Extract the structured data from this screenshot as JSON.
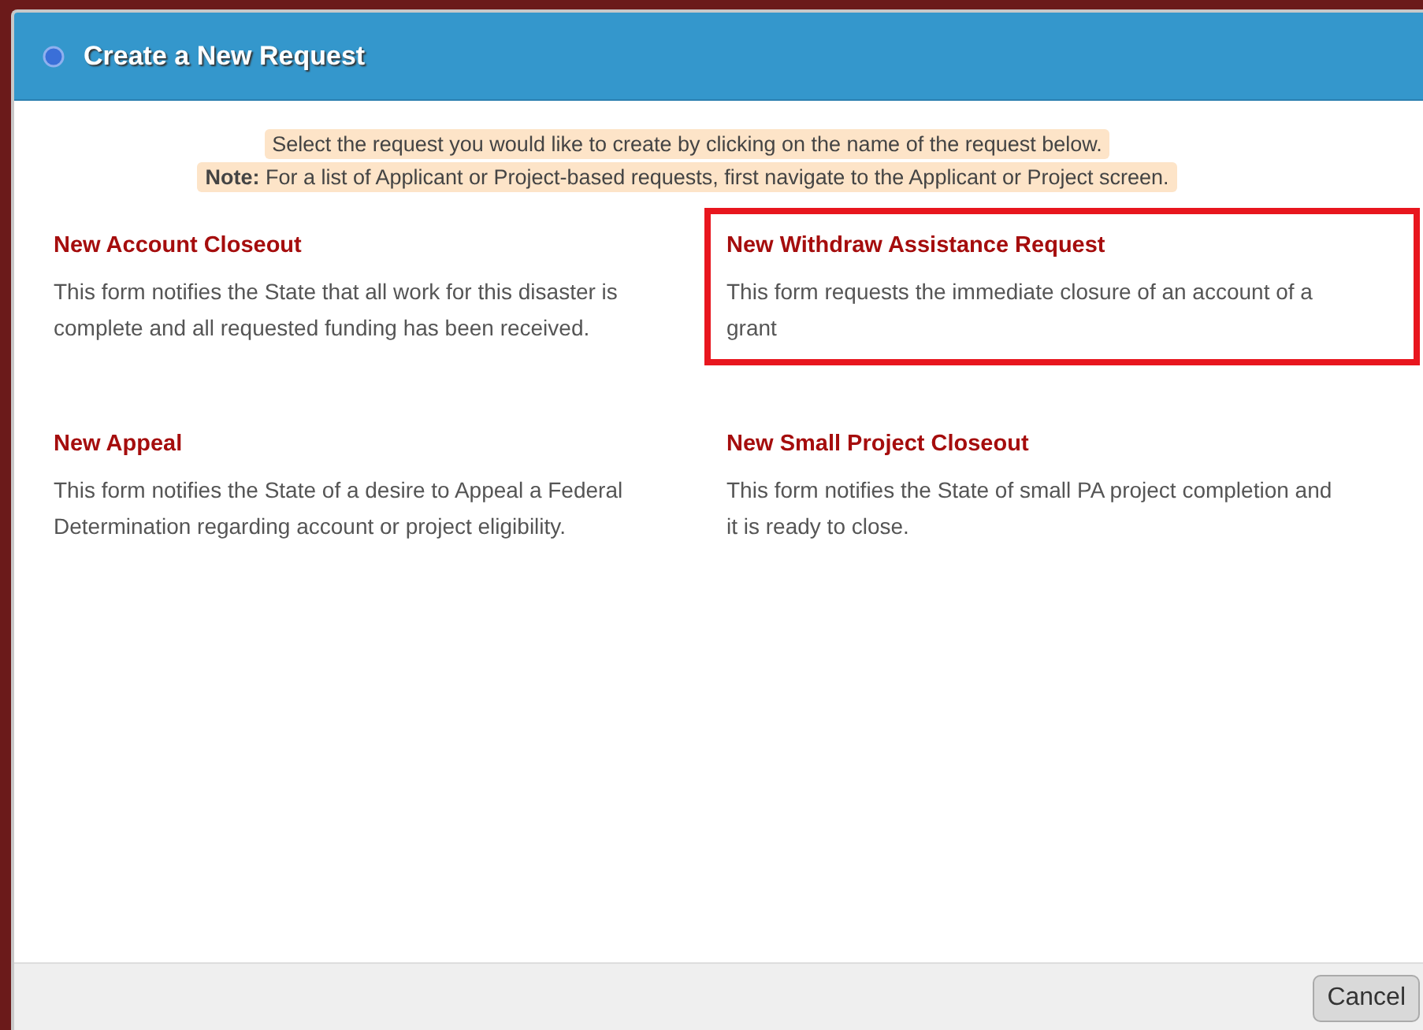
{
  "dialog": {
    "title": "Create a New Request"
  },
  "instructions": {
    "line_1": "Select the request you would like to create by clicking on the name of the request below.",
    "line_2": "**Note:** For a list of Applicant or Project-based requests, first navigate to the Applicant or Project screen."
  },
  "requests": [
    {
      "title": "New Account Closeout",
      "description": "This form notifies the State that all work for this disaster is complete and all requested funding has been received.",
      "highlighted": false
    },
    {
      "title": "New Withdraw Assistance Request",
      "description": "This form requests the immediate closure of an account of a grant",
      "highlighted": true
    },
    {
      "title": "New Appeal",
      "description": "This form notifies the State of a desire to Appeal a Federal Determination regarding account or project eligibility.",
      "highlighted": false
    },
    {
      "title": "New Small Project Closeout",
      "description": "This form notifies the State of small PA project completion and it is ready to close.",
      "highlighted": false
    }
  ],
  "buttons": [
    "Cancel"
  ]
}
